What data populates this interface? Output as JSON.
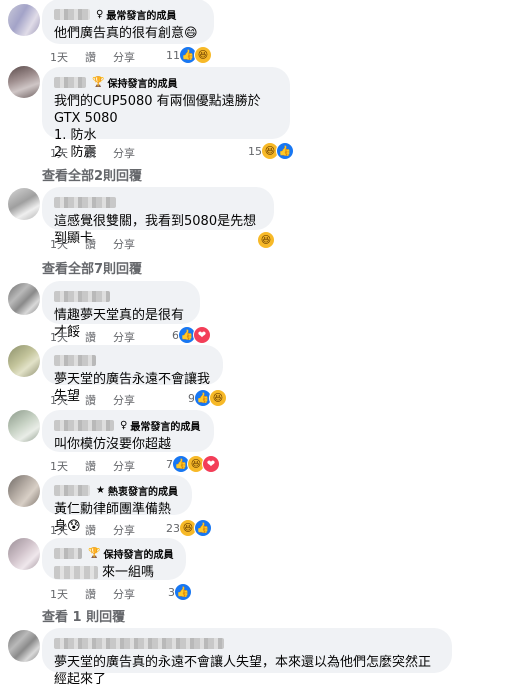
{
  "badges": {
    "top_fan": "最常發言的成員",
    "keeper": "保持發言的成員",
    "rising": "熱衷發言的成員"
  },
  "actions": {
    "like": "讚",
    "reply": "分享"
  },
  "comments": [
    {
      "badge": "最常發言的成員",
      "text": "他們廣告真的很有創意😄",
      "time": "1天",
      "like": "讚",
      "share": "分享",
      "count": "11"
    },
    {
      "badge": "保持發言的成員",
      "text": "我們的CUP5080 有兩個優點遠勝於GTX 5080\n1. 防水\n2. 防震",
      "time": "1天",
      "like": "讚",
      "share": "分享",
      "count": "15"
    },
    {
      "text": "這感覺很雙關，我看到5080是先想到顯卡",
      "time": "1天",
      "like": "讚",
      "share": "分享"
    },
    {
      "text": "情趣夢天堂真的是很有才餒",
      "time": "1天",
      "like": "讚",
      "share": "分享",
      "count": "6"
    },
    {
      "text": "夢天堂的廣告永遠不會讓我失望",
      "time": "1天",
      "like": "讚",
      "share": "分享",
      "count": "9"
    },
    {
      "badge": "最常發言的成員",
      "text": "叫你模仿沒要你超越",
      "time": "1天",
      "like": "讚",
      "share": "分享",
      "count": "7"
    },
    {
      "badge": "熱衷發言的成員",
      "text": "黃仁勳律師團準備熱身😰",
      "time": "1天",
      "like": "讚",
      "share": "分享",
      "count": "23"
    },
    {
      "badge": "保持發言的成員",
      "text": "來一組嗎",
      "time": "1天",
      "like": "讚",
      "share": "分享",
      "count": "3"
    },
    {
      "text": "夢天堂的廣告真的永遠不會讓人失望，本來還以為他們怎麼突然正經起來了"
    }
  ],
  "view_more": [
    "查看全部2則回覆",
    "查看全部7則回覆",
    "查看 1 則回覆"
  ],
  "icons": {
    "like": "thumbs-up-icon",
    "haha": "haha-emoji-icon",
    "love": "heart-icon",
    "badge_top": "trophy-badge-icon",
    "badge_keep": "trophy-badge-icon",
    "badge_rise": "star-badge-icon"
  },
  "colors": {
    "bubble": "#f0f2f5",
    "meta": "#65676b",
    "like": "#1877f2",
    "haha": "#f7b928",
    "love": "#f33e58"
  }
}
